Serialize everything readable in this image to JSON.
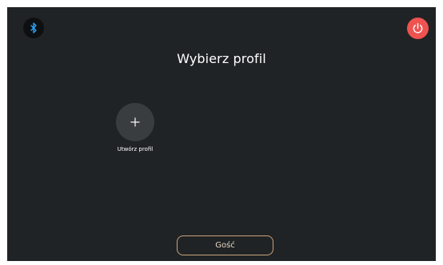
{
  "header": {
    "bluetooth_icon": "bluetooth-icon",
    "power_icon": "power-icon",
    "title": "Wybierz profil"
  },
  "profiles": {
    "create_icon": "plus-icon",
    "create_label": "Utwórz profil"
  },
  "footer": {
    "guest_label": "Gość"
  },
  "colors": {
    "background": "#202325",
    "power_accent": "#ef5350",
    "bluetooth_accent": "#2aa6ff",
    "guest_border": "#c9a27a"
  }
}
